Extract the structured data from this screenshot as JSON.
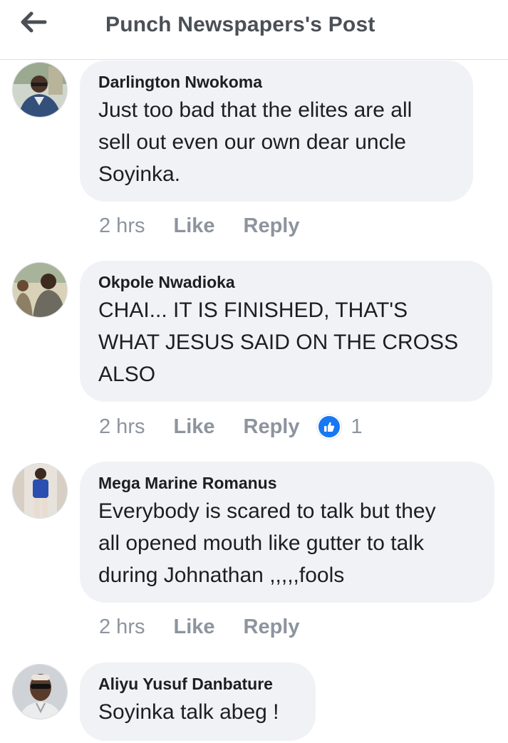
{
  "header": {
    "title": "Punch Newspapers's Post",
    "back_icon": "arrow-left-icon"
  },
  "colors": {
    "bubble": "#f0f2f5",
    "meta_text": "#8d949e",
    "like_blue": "#1877f2",
    "title_text": "#4b4f56"
  },
  "comments": [
    {
      "author": "Darlington Nwokoma",
      "lines": [
        "Just too bad that the elites are all",
        "sell out even our own dear uncle",
        "Soyinka."
      ],
      "time": "2 hrs",
      "like_label": "Like",
      "reply_label": "Reply"
    },
    {
      "author": "Okpole Nwadioka",
      "lines": [
        "CHAI... IT IS FINISHED, THAT'S",
        "WHAT JESUS SAID ON THE CROSS",
        "ALSO"
      ],
      "time": "2 hrs",
      "like_label": "Like",
      "reply_label": "Reply",
      "reaction_count": "1",
      "reaction_icon": "thumbs-up-icon"
    },
    {
      "author": "Mega Marine Romanus",
      "lines": [
        "Everybody is scared to talk but they",
        "all opened mouth like gutter to talk",
        "during Johnathan ,,,,,fools"
      ],
      "time": "2 hrs",
      "like_label": "Like",
      "reply_label": "Reply"
    },
    {
      "author": "Aliyu Yusuf Danbature",
      "lines": [
        "Soyinka talk abeg !"
      ]
    }
  ]
}
